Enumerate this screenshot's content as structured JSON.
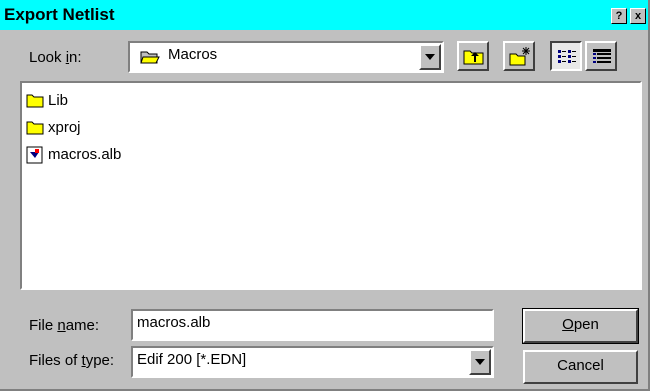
{
  "dialog": {
    "title": "Export Netlist",
    "help_glyph": "?",
    "close_glyph": "x"
  },
  "look_in": {
    "label_pre": "Look ",
    "label_key": "i",
    "label_post": "n:",
    "value": "Macros"
  },
  "toolbar": {
    "up_icon": "up-folder-icon",
    "new_folder_icon": "new-folder-icon",
    "list_view_icon": "list-view-icon",
    "details_view_icon": "details-view-icon"
  },
  "files": [
    {
      "name": "Lib",
      "icon": "folder-icon"
    },
    {
      "name": "xproj",
      "icon": "folder-icon"
    },
    {
      "name": "macros.alb",
      "icon": "file-icon"
    }
  ],
  "file_name": {
    "label_pre": "File ",
    "label_key": "n",
    "label_post": "ame:",
    "value": "macros.alb"
  },
  "file_type": {
    "label_pre": "Files of ",
    "label_key": "t",
    "label_post": "ype:",
    "value": "Edif 200 [*.EDN]"
  },
  "buttons": {
    "open_key": "O",
    "open_rest": "pen",
    "cancel": "Cancel"
  },
  "colors": {
    "titlebar": "#00ffff",
    "face": "#c0c0c0",
    "folder": "#ffff00"
  }
}
